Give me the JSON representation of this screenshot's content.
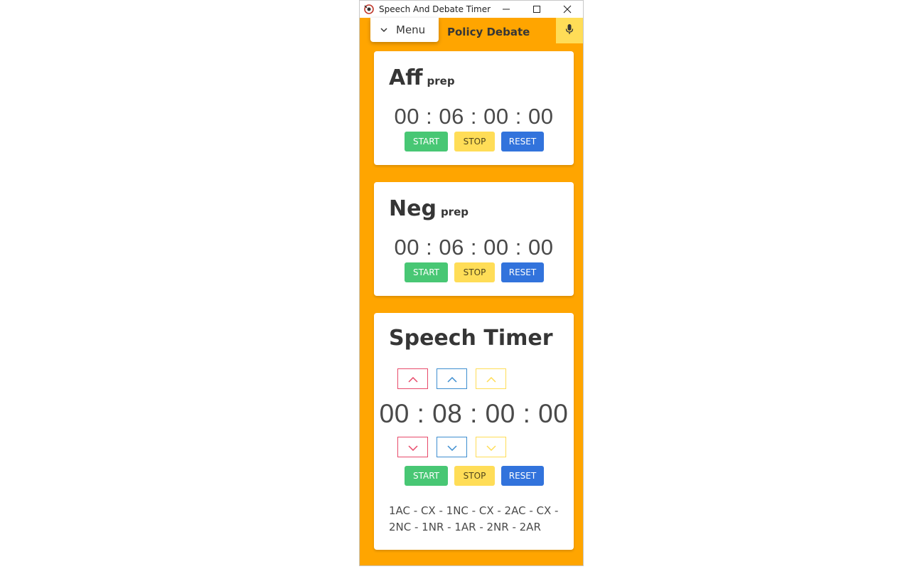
{
  "window": {
    "title": "Speech And Debate Timer"
  },
  "header": {
    "menu_label": "Menu",
    "format_title": "Policy Debate"
  },
  "aff_card": {
    "title": "Aff",
    "subtitle": "prep",
    "time": "00 : 06 : 00 : 00",
    "start_label": "START",
    "stop_label": "STOP",
    "reset_label": "RESET"
  },
  "neg_card": {
    "title": "Neg",
    "subtitle": "prep",
    "time": "00 : 06 : 00 : 00",
    "start_label": "START",
    "stop_label": "STOP",
    "reset_label": "RESET"
  },
  "speech_card": {
    "title": "Speech Timer",
    "time": "00 : 08 : 00 : 00",
    "start_label": "START",
    "stop_label": "STOP",
    "reset_label": "RESET",
    "sequence": "1AC - CX - 1NC - CX - 2AC - CX - 2NC - 1NR - 1AR - 2NR - 2AR"
  },
  "icons": {
    "app": "app-logo-icon",
    "menu_chevron": "chevron-down-icon",
    "mic": "microphone-icon",
    "increment": "chevron-up-icon",
    "decrement": "chevron-down-icon"
  },
  "colors": {
    "background": "#ffa500",
    "start": "#48c774",
    "stop": "#ffdd57",
    "reset": "#3273dc",
    "adjust_red": "#e84a6a",
    "adjust_blue": "#3e8ed0",
    "adjust_yellow": "#ffdd57"
  }
}
